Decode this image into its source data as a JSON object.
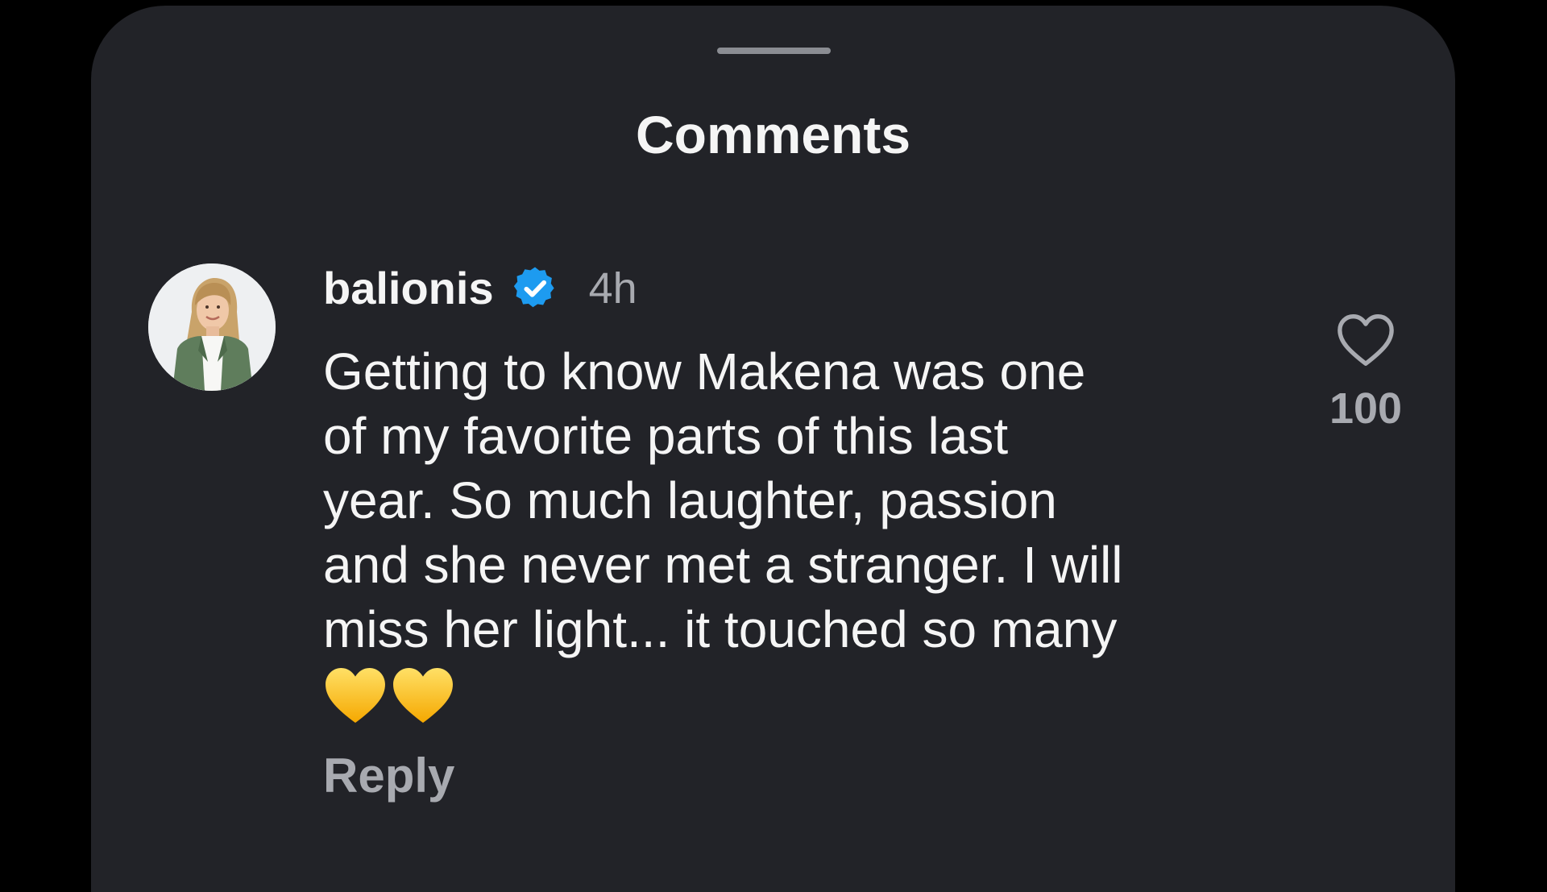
{
  "sheet": {
    "title": "Comments"
  },
  "comment": {
    "username": "balionis",
    "verified": true,
    "timestamp": "4h",
    "text": "Getting to know Makena was one\nof my favorite parts of this last\nyear. So much laughter, passion\nand she never met a stranger. I will\nmiss her light... it touched so many",
    "emojis": [
      "yellow-heart-emoji",
      "yellow-heart-emoji"
    ],
    "reply_label": "Reply",
    "like_count": "100"
  },
  "icons": {
    "drag_handle": "drag-handle",
    "verified": "verified-badge-icon",
    "like": "heart-outline-icon",
    "avatar": "profile-photo"
  },
  "colors": {
    "background": "#000000",
    "sheet": "#222328",
    "primary_text": "#f5f5f5",
    "secondary_text": "#a8aab0",
    "verified_blue": "#1d9bf0",
    "emoji_yellow": "#ffc61a"
  }
}
